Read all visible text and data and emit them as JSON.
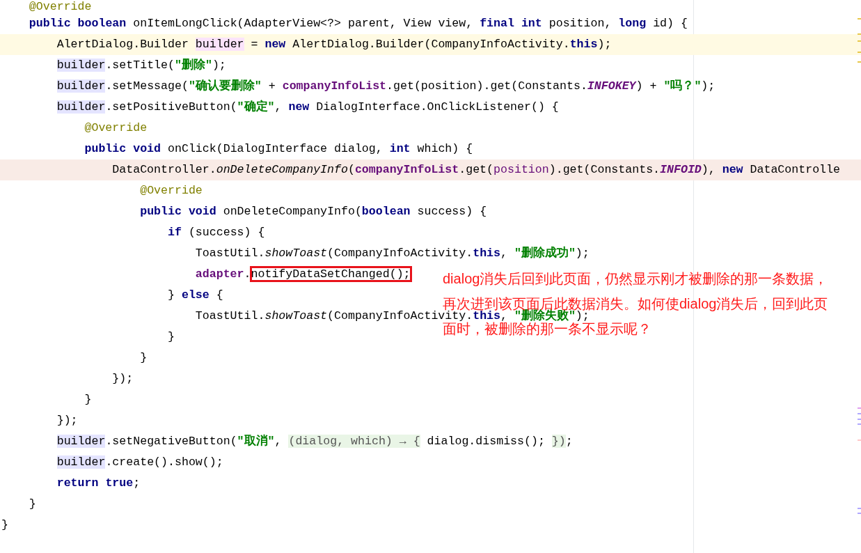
{
  "editor": {
    "lines": [
      {
        "tokens": [
          {
            "t": "    @Override",
            "kind": "annotation"
          }
        ]
      },
      {
        "tokens": [
          {
            "t": "    public boolean",
            "kind": "keyword"
          },
          {
            "t": " onItemLongClick(AdapterView<?> parent, View view, "
          },
          {
            "t": "final int",
            "kind": "keyword"
          },
          {
            "t": " position, "
          },
          {
            "t": "long",
            "kind": "keyword"
          },
          {
            "t": " id) {"
          }
        ]
      },
      {
        "kind": "caret",
        "tokens": [
          {
            "t": "        AlertDialog.Builder "
          },
          {
            "t": "builder",
            "kind": "write_usage"
          },
          {
            "t": " = "
          },
          {
            "t": "new",
            "kind": "keyword"
          },
          {
            "t": " AlertDialog.Builder(CompanyInfoActivity."
          },
          {
            "t": "this",
            "kind": "keyword"
          },
          {
            "t": ");"
          }
        ]
      },
      {
        "tokens": [
          {
            "t": "        builder",
            "kind": "read_usage"
          },
          {
            "t": ".setTitle("
          },
          {
            "t": "\"删除\"",
            "kind": "string"
          },
          {
            "t": ");"
          }
        ]
      },
      {
        "tokens": [
          {
            "t": "        builder",
            "kind": "read_usage"
          },
          {
            "t": ".setMessage("
          },
          {
            "t": "\"确认要删除\"",
            "kind": "string"
          },
          {
            "t": " + "
          },
          {
            "t": "companyInfoList",
            "kind": "field"
          },
          {
            "t": ".get(position).get(Constants."
          },
          {
            "t": "INFOKEY",
            "kind": "constant"
          },
          {
            "t": ") + "
          },
          {
            "t": "\"吗？\"",
            "kind": "string"
          },
          {
            "t": ");"
          }
        ]
      },
      {
        "tokens": [
          {
            "t": "        builder",
            "kind": "read_usage"
          },
          {
            "t": ".setPositiveButton("
          },
          {
            "t": "\"确定\"",
            "kind": "string"
          },
          {
            "t": ", "
          },
          {
            "t": "new",
            "kind": "keyword"
          },
          {
            "t": " DialogInterface.OnClickListener() {"
          }
        ]
      },
      {
        "tokens": [
          {
            "t": "            @Override",
            "kind": "annotation"
          }
        ]
      },
      {
        "tokens": [
          {
            "t": "            public void",
            "kind": "keyword"
          },
          {
            "t": " onClick(DialogInterface dialog, "
          },
          {
            "t": "int",
            "kind": "keyword"
          },
          {
            "t": " which) {"
          }
        ]
      },
      {
        "kind": "error",
        "tokens": [
          {
            "t": "                DataController."
          },
          {
            "t": "onDeleteCompanyInfo",
            "kind": "static"
          },
          {
            "t": "("
          },
          {
            "t": "companyInfoList",
            "kind": "field"
          },
          {
            "t": ".get("
          },
          {
            "t": "position",
            "kind": "param"
          },
          {
            "t": ").get(Constants."
          },
          {
            "t": "INFOID",
            "kind": "constant"
          },
          {
            "t": "), "
          },
          {
            "t": "new",
            "kind": "keyword"
          },
          {
            "t": " DataControlle"
          }
        ]
      },
      {
        "tokens": [
          {
            "t": "                    @Override",
            "kind": "annotation"
          }
        ]
      },
      {
        "tokens": [
          {
            "t": "                    public void",
            "kind": "keyword"
          },
          {
            "t": " onDeleteCompanyInfo("
          },
          {
            "t": "boolean",
            "kind": "keyword"
          },
          {
            "t": " success) {"
          }
        ]
      },
      {
        "tokens": [
          {
            "t": "                        if",
            "kind": "keyword"
          },
          {
            "t": " (success) {"
          }
        ]
      },
      {
        "tokens": [
          {
            "t": "                            ToastUtil."
          },
          {
            "t": "showToast",
            "kind": "static"
          },
          {
            "t": "(CompanyInfoActivity."
          },
          {
            "t": "this",
            "kind": "keyword"
          },
          {
            "t": ", "
          },
          {
            "t": "\"删除成功\"",
            "kind": "string"
          },
          {
            "t": ");"
          }
        ]
      },
      {
        "tokens": [
          {
            "t": "                            adapter",
            "kind": "field"
          },
          {
            "t": "."
          },
          {
            "t": "notifyDataSetChanged();",
            "kind": "boxed"
          }
        ]
      },
      {
        "tokens": [
          {
            "t": "                        } "
          },
          {
            "t": "else",
            "kind": "keyword"
          },
          {
            "t": " {"
          }
        ]
      },
      {
        "tokens": [
          {
            "t": "                            ToastUtil."
          },
          {
            "t": "showToast",
            "kind": "static"
          },
          {
            "t": "(CompanyInfoActivity."
          },
          {
            "t": "this",
            "kind": "keyword"
          },
          {
            "t": ", "
          },
          {
            "t": "\"删除失败\"",
            "kind": "string"
          },
          {
            "t": ");"
          }
        ]
      },
      {
        "tokens": [
          {
            "t": "                        }"
          }
        ]
      },
      {
        "tokens": [
          {
            "t": "                    }"
          }
        ]
      },
      {
        "tokens": [
          {
            "t": "                });"
          }
        ]
      },
      {
        "tokens": [
          {
            "t": "            }"
          }
        ]
      },
      {
        "tokens": [
          {
            "t": "        });"
          }
        ]
      },
      {
        "tokens": [
          {
            "t": "        builder",
            "kind": "read_usage"
          },
          {
            "t": ".setNegativeButton("
          },
          {
            "t": "\"取消\"",
            "kind": "string"
          },
          {
            "t": ", "
          },
          {
            "t": "(dialog, which) → {",
            "kind": "folded"
          },
          {
            "t": " dialog.dismiss(); "
          },
          {
            "t": "})",
            "kind": "folded"
          },
          {
            "t": ";"
          }
        ]
      },
      {
        "tokens": [
          {
            "t": "        builder",
            "kind": "read_usage"
          },
          {
            "t": ".create().show();"
          }
        ]
      },
      {
        "tokens": [
          {
            "t": "        return true",
            "kind": "keyword"
          },
          {
            "t": ";"
          }
        ]
      },
      {
        "tokens": [
          {
            "t": "    }"
          }
        ]
      },
      {
        "tokens": [
          {
            "t": "}"
          }
        ]
      }
    ]
  },
  "note": {
    "lines": [
      "dialog消失后回到此页面，仍然显示刚才被删除的那一条数据，",
      "再次进到该页面后此数据消失。如何使dialog消失后，回到此页",
      "面时，被删除的那一条不显示呢？"
    ]
  }
}
